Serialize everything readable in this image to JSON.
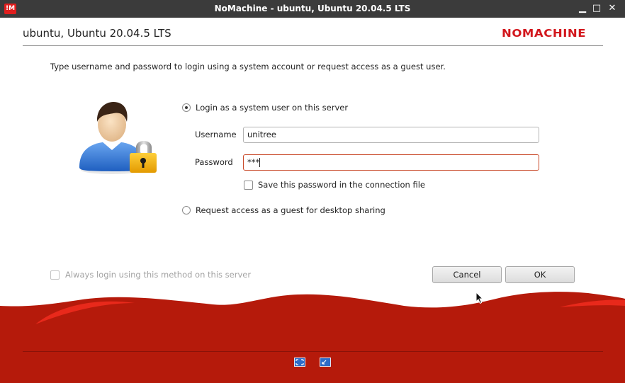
{
  "window": {
    "title": "NoMachine - ubuntu, Ubuntu 20.04.5 LTS",
    "app_icon_text": "!M",
    "minimize_glyph": "▁",
    "maximize_glyph": "□",
    "close_glyph": "✕"
  },
  "header": {
    "title": "ubuntu, Ubuntu 20.04.5 LTS",
    "brand": "NOMACHINE"
  },
  "instructions": "Type username and password to login using a system account or request access as a guest user.",
  "login": {
    "system_option_label": "Login as a system user on this server",
    "system_option_selected": true,
    "username_label": "Username",
    "username_value": "unitree",
    "password_label": "Password",
    "password_value": "***",
    "save_password_label": "Save this password in the connection file",
    "save_password_checked": false,
    "guest_option_label": "Request access as a guest for desktop sharing",
    "guest_option_selected": false
  },
  "footer": {
    "always_login_label": "Always login using this method on this server",
    "always_login_checked": false,
    "cancel_label": "Cancel",
    "ok_label": "OK",
    "icons": [
      "fullscreen-icon",
      "restore-icon"
    ]
  },
  "colors": {
    "brand_red": "#d2171d",
    "wave_red": "#b51a0b",
    "titlebar": "#3b3b3b"
  }
}
